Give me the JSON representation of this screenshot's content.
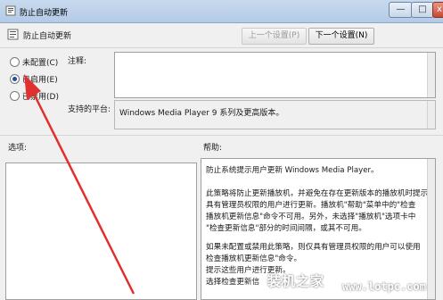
{
  "window": {
    "title": "防止自动更新",
    "minimize": "—",
    "maximize": "□",
    "close": "x"
  },
  "header": {
    "title": "防止自动更新",
    "prev_button": "上一个设置(P)",
    "next_button": "下一个设置(N)"
  },
  "options": [
    {
      "label": "未配置(C)",
      "selected": false
    },
    {
      "label": "已启用(E)",
      "selected": true
    },
    {
      "label": "已禁用(D)",
      "selected": false
    }
  ],
  "notes": {
    "label": "注释:"
  },
  "platform": {
    "label": "支持的平台:",
    "value": "Windows Media Player 9 系列及更高版本。"
  },
  "sections": {
    "options_label": "选项:",
    "help_label": "帮助:"
  },
  "help_lines": [
    "防止系统提示用户更新 Windows Media Player。",
    "",
    "此策略将防止更新播放机，并避免在存在更新版本的播放机时提示",
    "具有管理员权限的用户进行更新。播放机\"帮助\"菜单中的\"检查",
    "播放机更新信息\"命令不可用。另外，未选择\"播放机\"选项卡中",
    "\"检查更新信息\"部分的时间间隔，或其不可用。",
    "",
    "如果未配置或禁用此策略，则仅具有管理员权限的用户可以使用",
    "检查播放机更新信息\"命令。",
    "提示这些用户进行更新。",
    "选择检查更新信"
  ],
  "watermark": {
    "text": "装机之家",
    "url": "www.lotpc.com"
  }
}
